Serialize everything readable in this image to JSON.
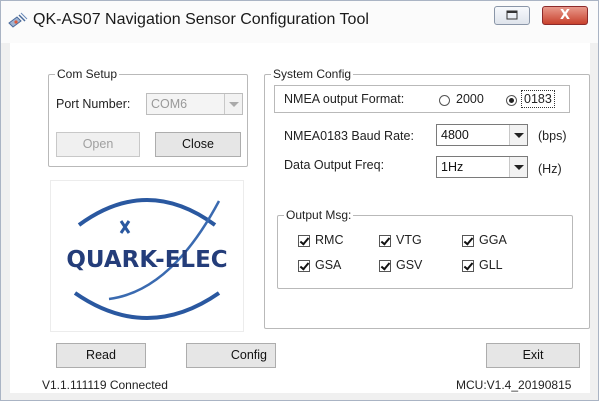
{
  "window": {
    "title": "QK-AS07 Navigation Sensor Configuration Tool",
    "close_glyph": "X"
  },
  "com_setup": {
    "legend": "Com Setup",
    "port_label": "Port Number:",
    "port_value": "COM6",
    "open_label": "Open",
    "close_label": "Close"
  },
  "system_config": {
    "legend": "System Config",
    "nmea_format_label": "NMEA output Format:",
    "format_options": [
      "2000",
      "0183"
    ],
    "format_selected": "0183",
    "baud_label": "NMEA0183 Baud Rate:",
    "baud_value": "4800",
    "baud_unit": "(bps)",
    "freq_label": "Data Output Freq:",
    "freq_value": "1Hz",
    "freq_unit": "(Hz)"
  },
  "output_msg": {
    "legend": "Output Msg:",
    "items": [
      {
        "label": "RMC",
        "checked": true
      },
      {
        "label": "VTG",
        "checked": true
      },
      {
        "label": "GGA",
        "checked": true
      },
      {
        "label": "GSA",
        "checked": true
      },
      {
        "label": "GSV",
        "checked": true
      },
      {
        "label": "GLL",
        "checked": true
      }
    ]
  },
  "logo": {
    "text": "QUARK-ELEC",
    "color": "#243d7a"
  },
  "buttons": {
    "read": "Read",
    "config": "Config",
    "exit": "Exit"
  },
  "status": {
    "left": "V1.1.111119 Connected",
    "right": "MCU:V1.4_20190815"
  },
  "icons": {
    "app": "satellite-icon",
    "restore": "restore-window-icon",
    "close": "close-window-icon"
  }
}
